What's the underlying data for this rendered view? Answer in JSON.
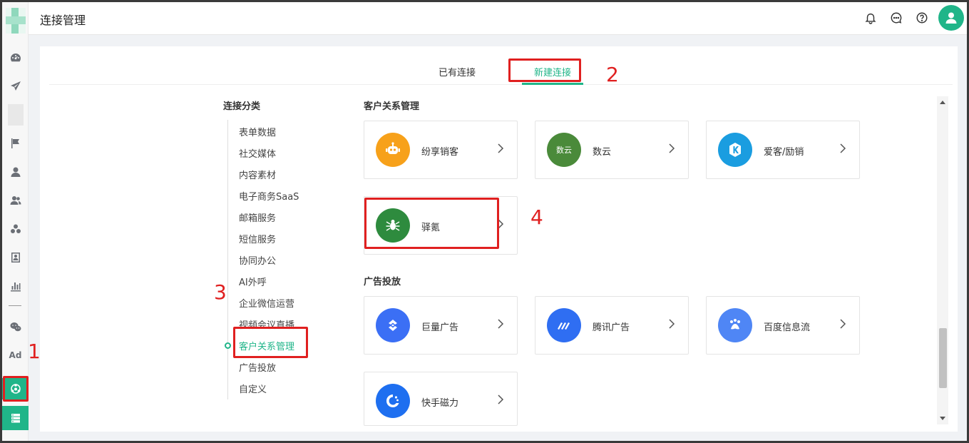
{
  "header": {
    "title": "连接管理"
  },
  "tabs": [
    {
      "label": "已有连接",
      "active": false
    },
    {
      "label": "新建连接",
      "active": true
    }
  ],
  "categories": {
    "title": "连接分类",
    "items": [
      {
        "label": "表单数据"
      },
      {
        "label": "社交媒体"
      },
      {
        "label": "内容素材"
      },
      {
        "label": "电子商务SaaS"
      },
      {
        "label": "邮箱服务"
      },
      {
        "label": "短信服务"
      },
      {
        "label": "协同办公"
      },
      {
        "label": "AI外呼"
      },
      {
        "label": "企业微信运营"
      },
      {
        "label": "视频会议直播"
      },
      {
        "label": "客户关系管理",
        "active": true
      },
      {
        "label": "广告投放"
      },
      {
        "label": "自定义"
      }
    ]
  },
  "sections": [
    {
      "title": "客户关系管理",
      "cards": [
        {
          "name": "纷享销客",
          "icon": "robot-icon",
          "color": "#f7a11a"
        },
        {
          "name": "数云",
          "icon": "shuyun-logo",
          "color": "#4a8a3a",
          "icon_text": "数云"
        },
        {
          "name": "爱客/励销",
          "icon": "k-logo",
          "color": "#1a9de0"
        },
        {
          "name": "驿氪",
          "icon": "spider-icon",
          "color": "#2e8b3e"
        }
      ]
    },
    {
      "title": "广告投放",
      "cards": [
        {
          "name": "巨量广告",
          "icon": "juliang-logo",
          "color": "#3b6ff5"
        },
        {
          "name": "腾讯广告",
          "icon": "tencent-ad-logo",
          "color": "#2f6ef2"
        },
        {
          "name": "百度信息流",
          "icon": "baidu-logo",
          "color": "#4f86f5"
        },
        {
          "name": "快手磁力",
          "icon": "kuaishou-logo",
          "color": "#1e6ff0"
        }
      ]
    }
  ],
  "sidebar": {
    "ad_label": "Ad",
    "icons": [
      "dashboard-icon",
      "send-icon",
      "flag-icon",
      "user-icon",
      "users-icon",
      "cluster-icon",
      "contact-card-icon",
      "bar-chart-icon",
      "wechat-icon",
      "ad-icon",
      "connection-icon",
      "server-icon"
    ]
  },
  "annotations": [
    "1",
    "2",
    "3",
    "4"
  ]
}
